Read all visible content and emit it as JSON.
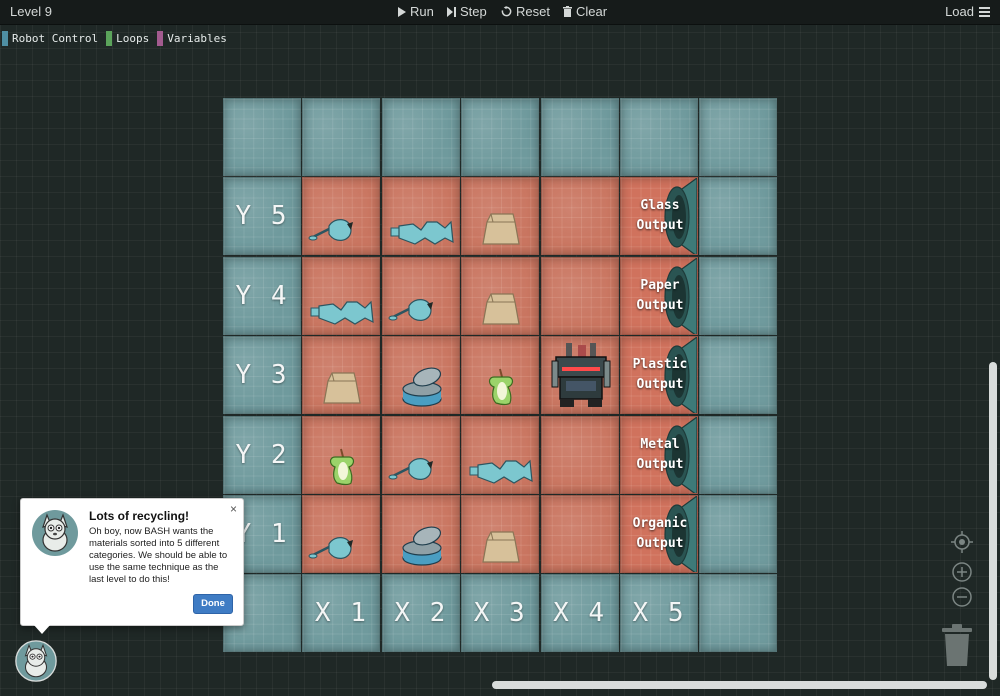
{
  "topbar": {
    "level": "Level 9",
    "run": "Run",
    "step": "Step",
    "reset": "Reset",
    "clear": "Clear",
    "load": "Load"
  },
  "categories": [
    {
      "label": "Robot Control",
      "color": "#4f8fa3"
    },
    {
      "label": "Loops",
      "color": "#5ba45b"
    },
    {
      "label": "Variables",
      "color": "#a35b8f"
    }
  ],
  "board": {
    "y_labels": [
      "Y 5",
      "Y 4",
      "Y 3",
      "Y 2",
      "Y 1"
    ],
    "x_labels": [
      "X 1",
      "X 2",
      "X 3",
      "X 4",
      "X 5"
    ],
    "outputs": [
      "Glass\nOutput",
      "Paper\nOutput",
      "Plastic\nOutput",
      "Metal\nOutput",
      "Organic\nOutput"
    ],
    "grid_items": [
      [
        "glass",
        "plastic",
        "paper",
        ""
      ],
      [
        "plastic",
        "glass",
        "paper",
        ""
      ],
      [
        "paper",
        "metal",
        "organic",
        "robot"
      ],
      [
        "organic",
        "glass",
        "plastic",
        ""
      ],
      [
        "glass",
        "metal",
        "paper",
        ""
      ]
    ]
  },
  "popup": {
    "title": "Lots of recycling!",
    "body": "Oh boy, now BASH wants the materials sorted into 5 different categories. We should be able to use the same technique as the last level to do this!",
    "close": "×",
    "done": "Done"
  },
  "colors": {
    "floor": "#c97560",
    "border_tile": "#6f9a9d",
    "funnel": "#3e7a78",
    "done_button": "#3f7cc4"
  }
}
